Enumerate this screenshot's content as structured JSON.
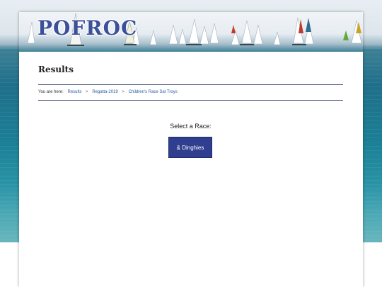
{
  "site": {
    "logo_text": "POFROC"
  },
  "page": {
    "title": "Results"
  },
  "breadcrumb": {
    "prefix": "You are here:",
    "items": [
      "Results",
      "Regatta-2019",
      "Children's Race Sat Troys"
    ],
    "separator": ">"
  },
  "race_select": {
    "label": "Select a Race:",
    "buttons": [
      {
        "label": "& Dinghies"
      }
    ]
  },
  "colors": {
    "accent": "#2f3e8e",
    "logo": "#3c4f99",
    "link": "#2c5aa0",
    "rule": "#4a567a"
  }
}
